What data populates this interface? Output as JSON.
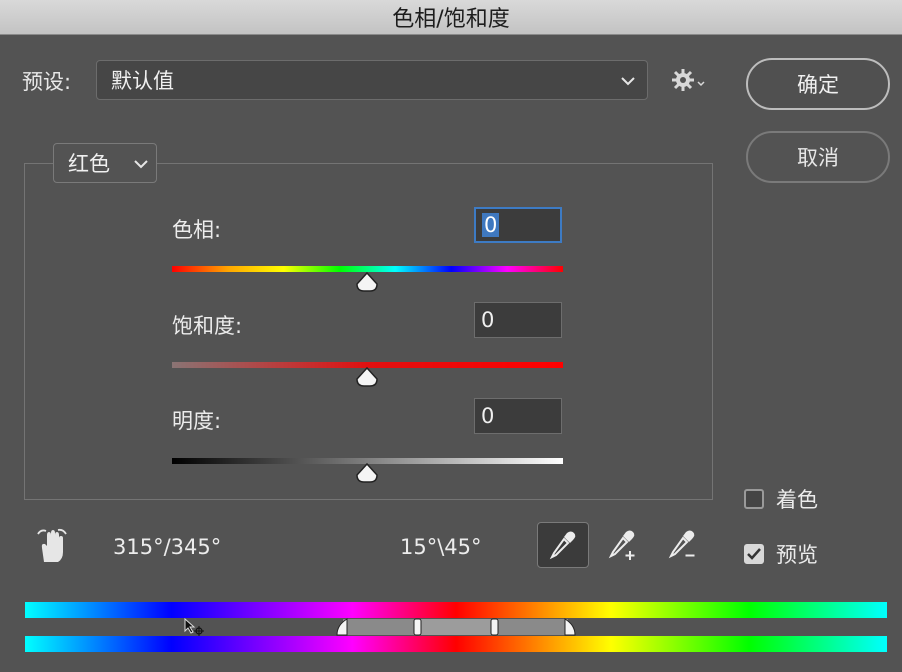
{
  "window": {
    "title": "色相/饱和度"
  },
  "preset": {
    "label": "预设:",
    "value": "默认值"
  },
  "buttons": {
    "ok": "确定",
    "cancel": "取消"
  },
  "channel": {
    "value": "红色"
  },
  "sliders": {
    "hue": {
      "label": "色相:",
      "value": "0"
    },
    "saturation": {
      "label": "饱和度:",
      "value": "0"
    },
    "lightness": {
      "label": "明度:",
      "value": "0"
    }
  },
  "range": {
    "left": "315°/345°",
    "right": "15°\\45°"
  },
  "options": {
    "colorize": {
      "label": "着色",
      "checked": false
    },
    "preview": {
      "label": "预览",
      "checked": true
    }
  },
  "icons": {
    "gear": "gear-icon",
    "hand": "hand-adjust-icon",
    "eyedropper": "eyedropper-icon",
    "eyedropper_add": "eyedropper-add-icon",
    "eyedropper_subtract": "eyedropper-subtract-icon"
  },
  "colors": {
    "focus": "#3d7bc4",
    "panel": "#535353"
  }
}
